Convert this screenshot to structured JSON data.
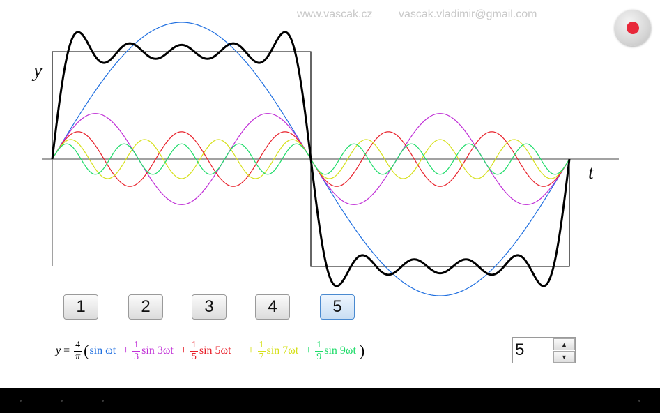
{
  "credits": {
    "website": "www.vascak.cz",
    "email": "vascak.vladimir@gmail.com"
  },
  "axes": {
    "y_label": "y",
    "x_label": "t"
  },
  "harmonic_buttons": [
    {
      "label": "1"
    },
    {
      "label": "2"
    },
    {
      "label": "3"
    },
    {
      "label": "4"
    },
    {
      "label": "5"
    }
  ],
  "active_harmonic_count": 5,
  "formula": {
    "lhs": "y",
    "equals": "=",
    "prefactor_num": "4",
    "prefactor_den": "π",
    "open_paren": "(",
    "close_paren": ")",
    "plus": "+",
    "terms": [
      {
        "coef_num": "",
        "coef_den": "",
        "text": "sin ωt",
        "color": "#1f6fe0"
      },
      {
        "coef_num": "1",
        "coef_den": "3",
        "text": "sin 3ωt",
        "color": "#c02fd6"
      },
      {
        "coef_num": "1",
        "coef_den": "5",
        "text": "sin 5ωt",
        "color": "#e8202a"
      },
      {
        "coef_num": "1",
        "coef_den": "7",
        "text": "sin 7ωt",
        "color": "#d6e01a"
      },
      {
        "coef_num": "1",
        "coef_den": "9",
        "text": "sin 9ωt",
        "color": "#1fdc6a"
      }
    ]
  },
  "spinner": {
    "value": "5",
    "up_icon": "triangle-up",
    "down_icon": "triangle-down"
  },
  "colors": {
    "square_wave": "#000000",
    "sum_curve": "#000000",
    "harmonic_1": "#1f6fe0",
    "harmonic_3": "#c02fd6",
    "harmonic_5": "#e8202a",
    "harmonic_7": "#d6e01a",
    "harmonic_9": "#1fdc6a",
    "record_button": "#e8283a"
  }
}
